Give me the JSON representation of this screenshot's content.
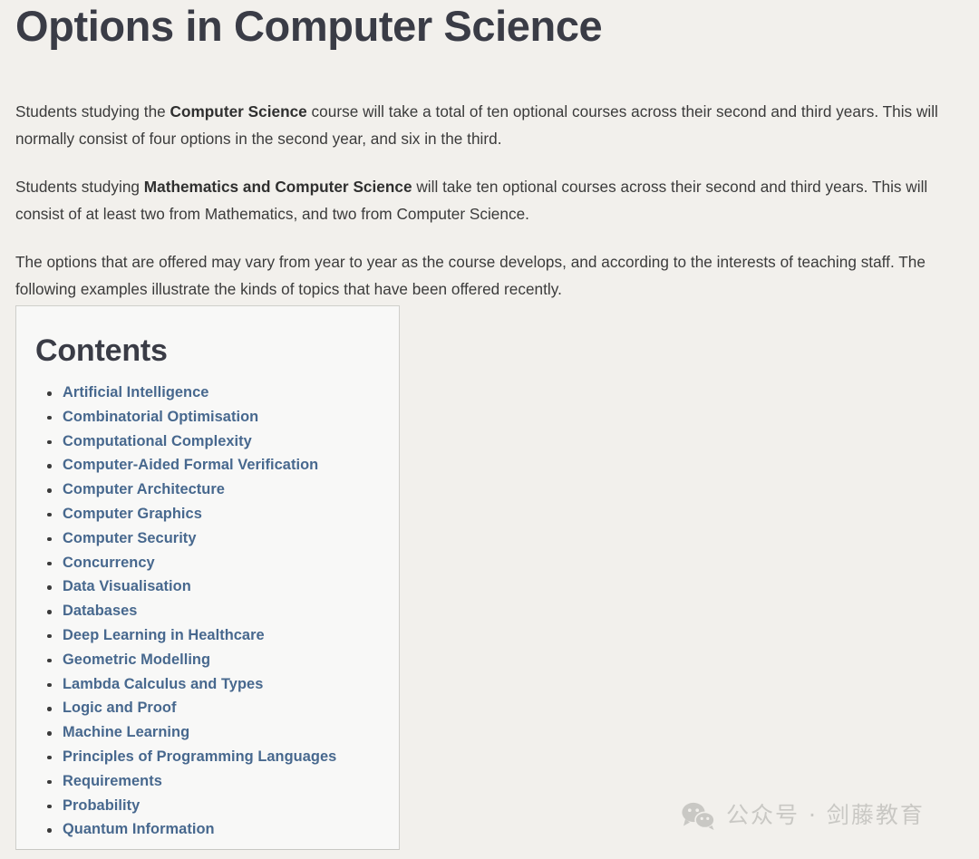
{
  "page": {
    "title": "Options in Computer Science",
    "background_color": "#f2f0ec",
    "heading_color": "#3a3c46",
    "link_color": "#47688e"
  },
  "intro": {
    "paragraphs": [
      {
        "segments": [
          {
            "text": "Students studying the ",
            "bold": false
          },
          {
            "text": "Computer Science",
            "bold": true
          },
          {
            "text": " course will take a total of ten optional courses across their second and third years. This will normally consist of four options in the second year, and six in the third.",
            "bold": false
          }
        ]
      },
      {
        "segments": [
          {
            "text": "Students studying ",
            "bold": false
          },
          {
            "text": "Mathematics and Computer Science",
            "bold": true
          },
          {
            "text": " will take ten optional courses across their second and third years. This will consist of at least two from Mathematics, and two from Computer Science.",
            "bold": false
          }
        ]
      },
      {
        "segments": [
          {
            "text": "The options that are offered may vary from year to year as the course develops, and according to the interests of teaching staff. The following examples illustrate the kinds of topics that have been offered recently.",
            "bold": false
          }
        ]
      }
    ]
  },
  "contents": {
    "heading": "Contents",
    "items": [
      "Artificial Intelligence",
      "Combinatorial Optimisation",
      "Computational Complexity",
      "Computer-Aided Formal Verification",
      "Computer Architecture",
      "Computer Graphics",
      "Computer Security",
      "Concurrency",
      "Data Visualisation",
      "Databases",
      "Deep Learning in Healthcare",
      "Geometric Modelling",
      "Lambda Calculus and Types",
      "Logic and Proof",
      "Machine Learning",
      "Principles of Programming Languages",
      "Requirements",
      "Probability",
      "Quantum Information"
    ]
  },
  "watermark": {
    "icon": "wechat-icon",
    "text": "公众号 · 剑藤教育",
    "color": "#c9c8c4"
  }
}
